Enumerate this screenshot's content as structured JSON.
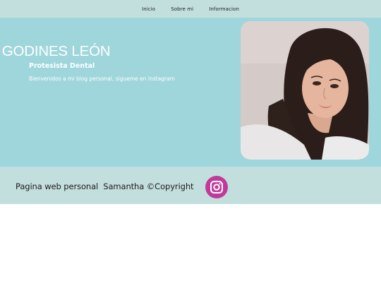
{
  "nav": {
    "items": [
      {
        "label": "Inicio"
      },
      {
        "label": "Sobre mi"
      },
      {
        "label": "Informacion"
      }
    ]
  },
  "hero": {
    "title": "THA GODINES LEÓN",
    "subtitle": "Protesista Dental",
    "tagline": "Bienvenidos a mi blog personal, sigueme en Instagram",
    "photo_icon": "profile-photo"
  },
  "footer": {
    "text": "Pagina web personal  Samantha ©Copyright",
    "social_icon": "instagram-icon"
  },
  "colors": {
    "nav_bg": "#c3dfdd",
    "hero_bg": "#9fd6db",
    "footer_bg": "#c3dfdd",
    "instagram": "#c13a9b",
    "hero_text": "#ffffff"
  }
}
